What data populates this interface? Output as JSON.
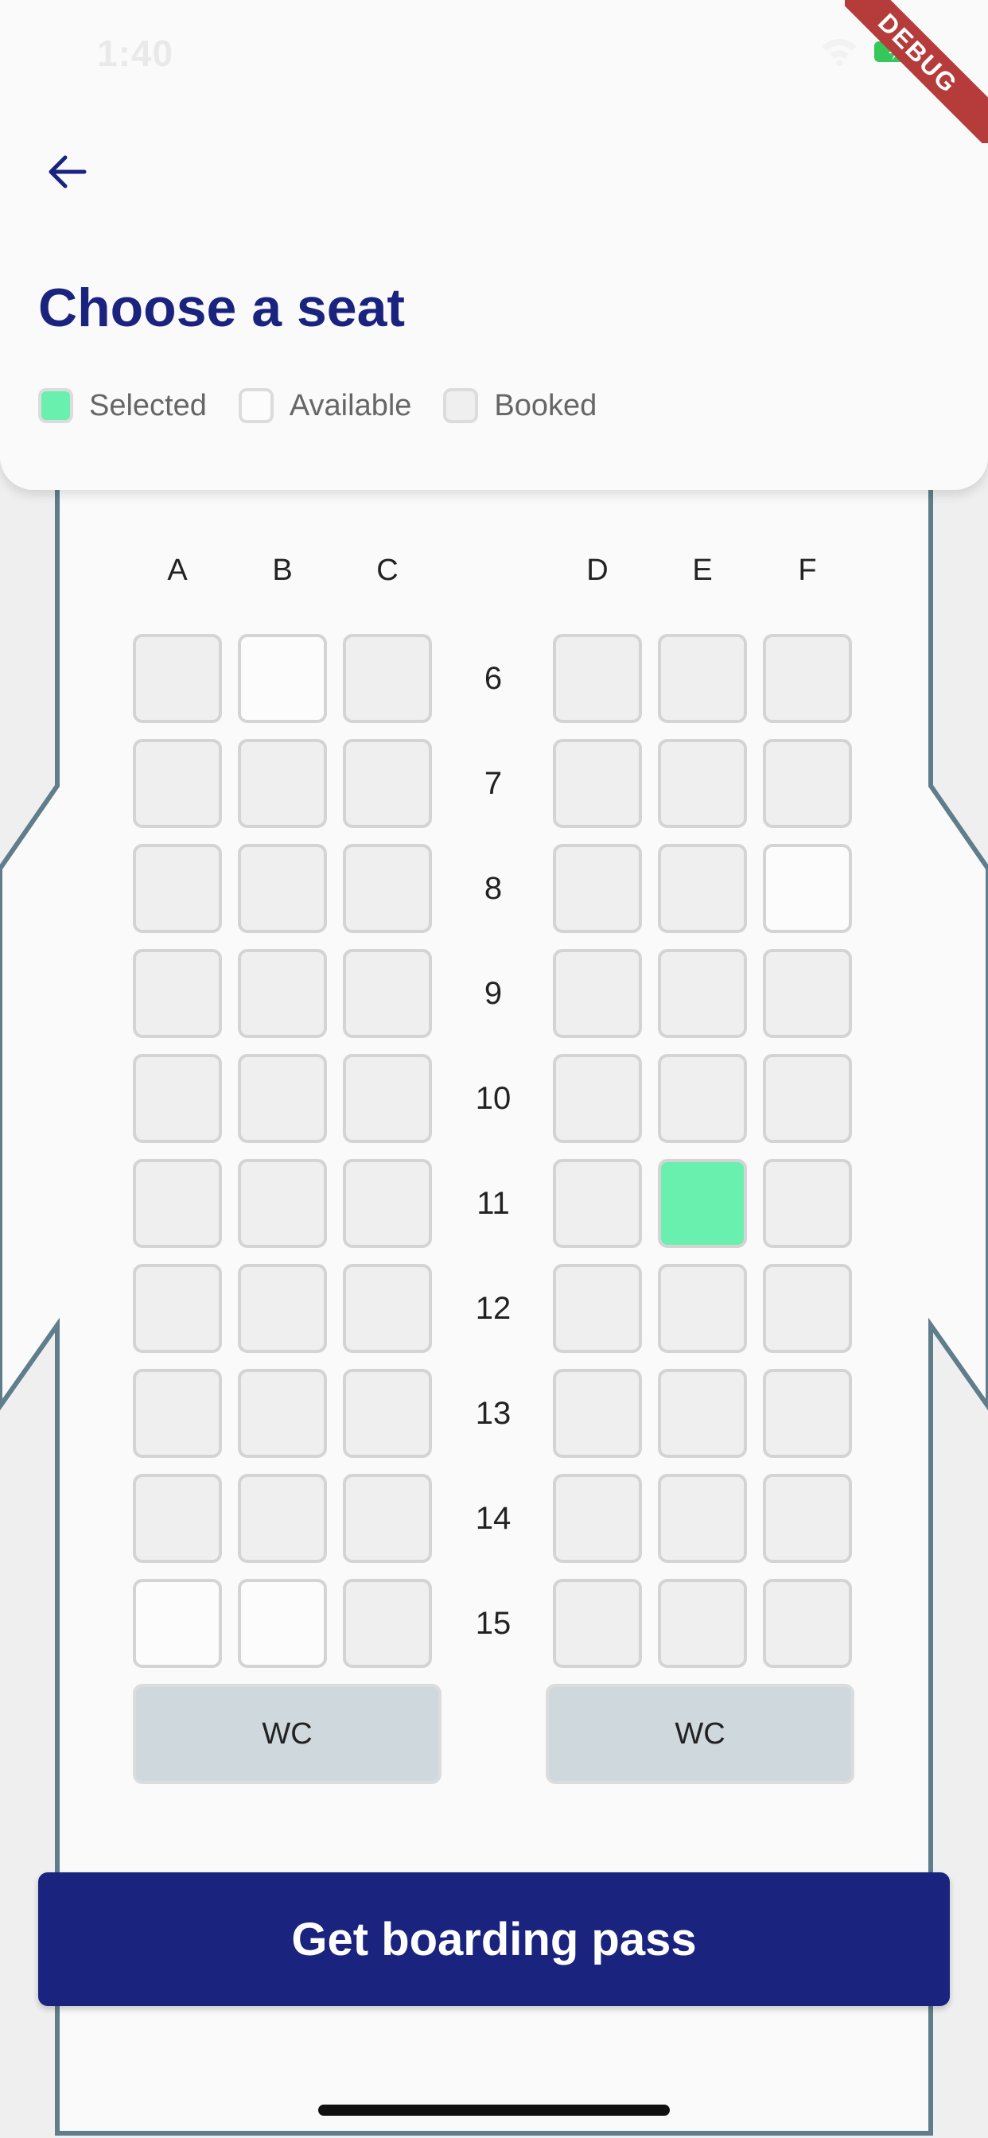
{
  "status_bar": {
    "time": "1:40",
    "icons": [
      "wifi-icon",
      "battery-charging-icon"
    ]
  },
  "debug_banner": "DEBUG",
  "header": {
    "back_icon": "arrow-left-icon",
    "title": "Choose a seat",
    "legend": [
      {
        "label": "Selected",
        "state": "selected"
      },
      {
        "label": "Available",
        "state": "available"
      },
      {
        "label": "Booked",
        "state": "booked"
      }
    ]
  },
  "seat_map": {
    "columns_left": [
      "A",
      "B",
      "C"
    ],
    "columns_right": [
      "D",
      "E",
      "F"
    ],
    "rows": [
      {
        "number": "6",
        "seats": [
          "booked",
          "available",
          "booked",
          "booked",
          "booked",
          "booked"
        ]
      },
      {
        "number": "7",
        "seats": [
          "booked",
          "booked",
          "booked",
          "booked",
          "booked",
          "booked"
        ]
      },
      {
        "number": "8",
        "seats": [
          "booked",
          "booked",
          "booked",
          "booked",
          "booked",
          "available"
        ]
      },
      {
        "number": "9",
        "seats": [
          "booked",
          "booked",
          "booked",
          "booked",
          "booked",
          "booked"
        ]
      },
      {
        "number": "10",
        "seats": [
          "booked",
          "booked",
          "booked",
          "booked",
          "booked",
          "booked"
        ]
      },
      {
        "number": "11",
        "seats": [
          "booked",
          "booked",
          "booked",
          "booked",
          "selected",
          "booked"
        ]
      },
      {
        "number": "12",
        "seats": [
          "booked",
          "booked",
          "booked",
          "booked",
          "booked",
          "booked"
        ]
      },
      {
        "number": "13",
        "seats": [
          "booked",
          "booked",
          "booked",
          "booked",
          "booked",
          "booked"
        ]
      },
      {
        "number": "14",
        "seats": [
          "booked",
          "booked",
          "booked",
          "booked",
          "booked",
          "booked"
        ]
      },
      {
        "number": "15",
        "seats": [
          "available",
          "available",
          "booked",
          "booked",
          "booked",
          "booked"
        ]
      }
    ],
    "restrooms": [
      "WC",
      "WC"
    ]
  },
  "footer": {
    "button_label": "Get boarding pass"
  },
  "colors": {
    "primary": "#1a237e",
    "selected": "#69f0ae",
    "available": "#fcfcfc",
    "booked": "#efefef",
    "restroom": "#cfd8dc",
    "fuselage_outline": "#607d8b",
    "debug": "#b63b3b"
  }
}
